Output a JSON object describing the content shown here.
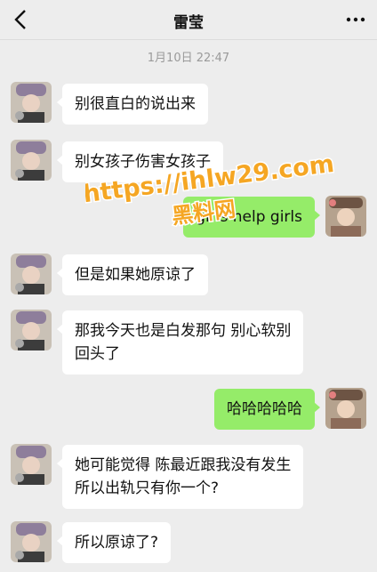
{
  "header": {
    "title": "雷莹",
    "back_icon": "chevron-left-icon",
    "more_icon": "ellipsis-icon"
  },
  "chat": {
    "timestamp": "1月10日 22:47",
    "messages": [
      {
        "from": "contact",
        "text": "别很直白的说出来"
      },
      {
        "from": "contact",
        "text": "别女孩子伤害女孩子"
      },
      {
        "from": "me",
        "text": "girls help girls"
      },
      {
        "from": "contact",
        "text": "但是如果她原谅了"
      },
      {
        "from": "contact",
        "text": "那我今天也是白发那句 别心软别\n回头了"
      },
      {
        "from": "me",
        "text": "哈哈哈哈哈"
      },
      {
        "from": "contact",
        "text": "她可能觉得 陈最近跟我没有发生\n所以出轨只有你一个?"
      },
      {
        "from": "contact",
        "text": "所以原谅了?"
      }
    ]
  },
  "watermark": {
    "line1": "https://ihlw29.com",
    "line2": "黑料网"
  },
  "colors": {
    "background": "#ededed",
    "incoming_bubble": "#ffffff",
    "outgoing_bubble": "#95ec69",
    "watermark_fill": "#f5a623"
  }
}
